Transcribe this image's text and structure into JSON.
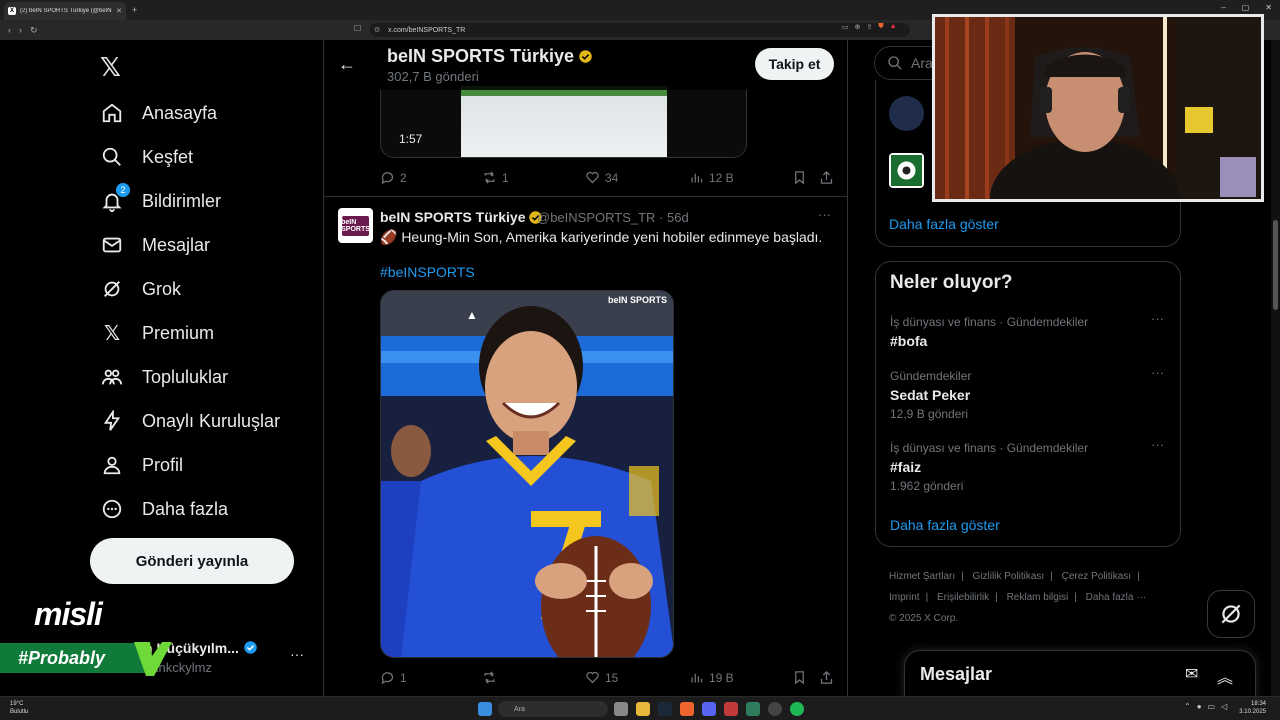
{
  "browser": {
    "tab_title": "(2) beIN SPORTS Türkiye (@beIN",
    "tab_favicon": "X",
    "url": "x.com/beINSPORTS_TR",
    "window_controls": [
      "–",
      "▢",
      "✕"
    ]
  },
  "nav": {
    "items": [
      {
        "label": "Anasayfa",
        "icon": "home-icon"
      },
      {
        "label": "Keşfet",
        "icon": "search-icon"
      },
      {
        "label": "Bildirimler",
        "icon": "bell-icon",
        "badge": "2"
      },
      {
        "label": "Mesajlar",
        "icon": "envelope-icon"
      },
      {
        "label": "Grok",
        "icon": "grok-icon"
      },
      {
        "label": "Premium",
        "icon": "x-logo-icon"
      },
      {
        "label": "Topluluklar",
        "icon": "people-icon"
      },
      {
        "label": "Onaylı Kuruluşlar",
        "icon": "lightning-icon"
      },
      {
        "label": "Profil",
        "icon": "person-icon"
      },
      {
        "label": "Daha fazla",
        "icon": "more-circle-icon"
      }
    ],
    "post_button": "Gönderi yayınla",
    "profile_name": "n Küçükyılm...",
    "profile_handle": "aankckylmz",
    "profile_more": "···"
  },
  "overlay": {
    "misli": "misli",
    "probably": "#Probably"
  },
  "header": {
    "name": "beIN SPORTS Türkiye",
    "posts_count": "302,7 B gönderi",
    "follow_button": "Takip et"
  },
  "prev_tweet": {
    "video_time": "1:57",
    "replies": "2",
    "retweets": "1",
    "likes": "34",
    "views": "12 B"
  },
  "tweet": {
    "author": "beIN SPORTS Türkiye",
    "handle_time": "@beINSPORTS_TR · 56d",
    "avatar_text": "beIN SPORTS",
    "text": "🏈 Heung-Min Son, Amerika kariyerinde yeni hobiler edinmeye başladı.",
    "hashtag": "#beINSPORTS",
    "photo_watermark": "beIN SPORTS",
    "more": "···",
    "replies": "1",
    "retweets": "",
    "likes": "15",
    "views": "19 B"
  },
  "right": {
    "search_placeholder": "Ara",
    "show_more_1": "Daha fazla göster",
    "trends_title": "Neler oluyor?",
    "trends": [
      {
        "context": "İş dünyası ve finans · Gündemdekiler",
        "name": "#bofa",
        "count": ""
      },
      {
        "context": "Gündemdekiler",
        "name": "Sedat Peker",
        "count": "12,9 B gönderi"
      },
      {
        "context": "İş dünyası ve finans · Gündemdekiler",
        "name": "#faiz",
        "count": "1.962 gönderi"
      }
    ],
    "show_more_2": "Daha fazla göster",
    "footer": [
      "Hizmet Şartları",
      "|",
      "Gizlilik Politikası",
      "|",
      "Çerez Politikası",
      "|",
      "Imprint",
      "|",
      "Erişilebilirlik",
      "|",
      "Reklam bilgisi",
      "|",
      "Daha fazla ···",
      "© 2025 X Corp."
    ],
    "messages_title": "Mesajlar"
  },
  "taskbar": {
    "weather_temp": "19°C",
    "weather_desc": "Bulutlu",
    "search": "Ara",
    "time": "18:34",
    "date": "3.10.2025"
  },
  "colors": {
    "accent": "#1d9bf0",
    "background": "#000000",
    "border": "#2f3336",
    "muted": "#71767b",
    "probably_green": "#0f7a3a"
  }
}
